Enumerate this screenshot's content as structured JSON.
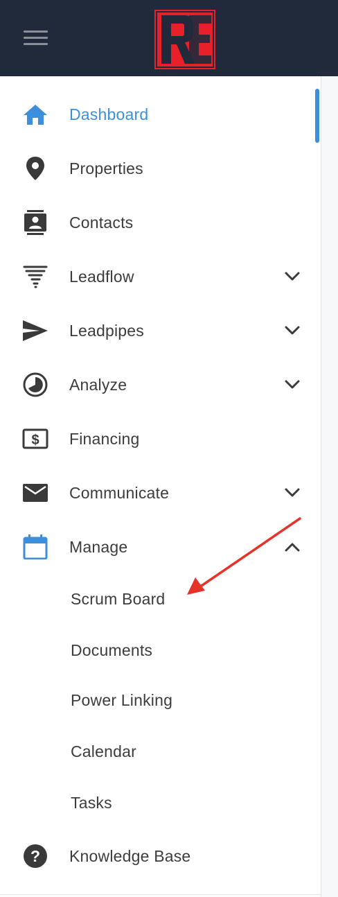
{
  "header": {
    "logo_text": "RE",
    "brand_color": "#e8202a",
    "bg_color": "#212a3b"
  },
  "nav": {
    "accent_color": "#3d8fdb",
    "items": [
      {
        "label": "Dashboard",
        "icon": "home-icon",
        "active": true
      },
      {
        "label": "Properties",
        "icon": "map-pin-icon"
      },
      {
        "label": "Contacts",
        "icon": "contacts-icon"
      },
      {
        "label": "Leadflow",
        "icon": "tornado-icon",
        "expandable": true
      },
      {
        "label": "Leadpipes",
        "icon": "send-icon",
        "expandable": true
      },
      {
        "label": "Analyze",
        "icon": "pie-chart-icon",
        "expandable": true
      },
      {
        "label": "Financing",
        "icon": "dollar-icon"
      },
      {
        "label": "Communicate",
        "icon": "mail-icon",
        "expandable": true
      },
      {
        "label": "Manage",
        "icon": "calendar-icon",
        "expanded": true
      },
      {
        "label": "Knowledge Base",
        "icon": "help-icon"
      }
    ],
    "manage_sub": [
      {
        "label": "Scrum Board"
      },
      {
        "label": "Documents"
      },
      {
        "label": "Power Linking"
      },
      {
        "label": "Calendar"
      },
      {
        "label": "Tasks"
      }
    ]
  },
  "annotation": {
    "arrow_color": "#e5332a",
    "points_to": "Scrum Board"
  }
}
